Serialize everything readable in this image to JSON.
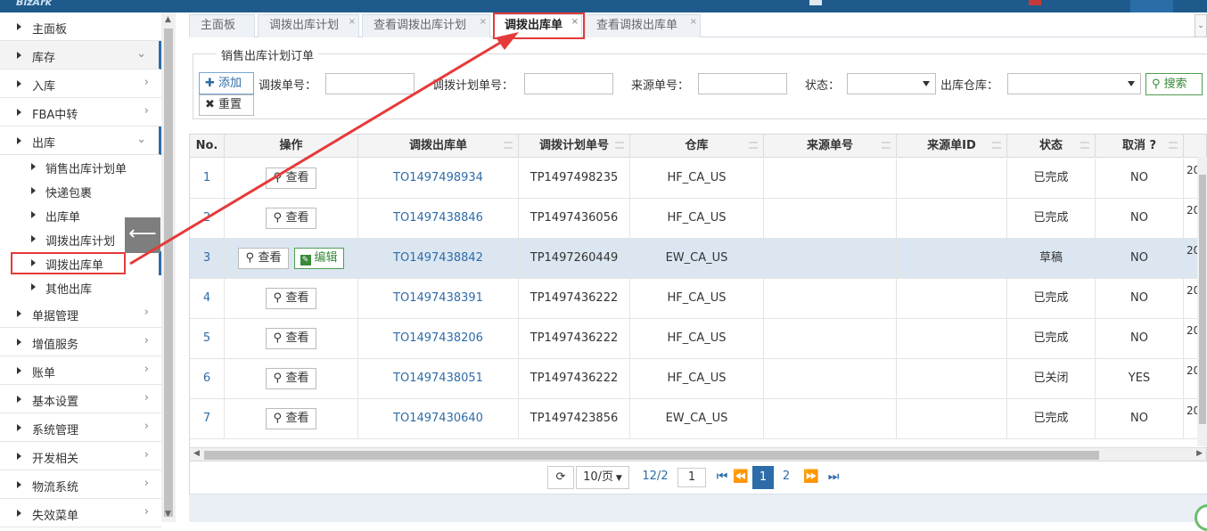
{
  "app": {
    "logo": "BizArk"
  },
  "sidebar": {
    "items": [
      {
        "label": "主面板",
        "chevron": ""
      },
      {
        "label": "库存",
        "chevron": "⌄"
      },
      {
        "label": "入库",
        "chevron": "›"
      },
      {
        "label": "FBA中转",
        "chevron": "›"
      },
      {
        "label": "出库",
        "chevron": "⌄"
      },
      {
        "label": "单据管理",
        "chevron": "›"
      },
      {
        "label": "增值服务",
        "chevron": "›"
      },
      {
        "label": "账单",
        "chevron": "›"
      },
      {
        "label": "基本设置",
        "chevron": "›"
      },
      {
        "label": "系统管理",
        "chevron": "›"
      },
      {
        "label": "开发相关",
        "chevron": "›"
      },
      {
        "label": "物流系统",
        "chevron": "›"
      },
      {
        "label": "失效菜单",
        "chevron": "›"
      }
    ],
    "subitems": [
      {
        "label": "销售出库计划单"
      },
      {
        "label": "快递包裹"
      },
      {
        "label": "出库单"
      },
      {
        "label": "调拨出库计划"
      },
      {
        "label": "调拨出库单"
      },
      {
        "label": "其他出库"
      }
    ],
    "collapse_icon": "⟵"
  },
  "tabs": [
    {
      "label": "主面板"
    },
    {
      "label": "调拨出库计划",
      "close": "×"
    },
    {
      "label": "查看调拨出库计划",
      "close": "×"
    },
    {
      "label": "调拨出库单",
      "close": "×"
    },
    {
      "label": "查看调拨出库单",
      "close": "×"
    }
  ],
  "filter": {
    "legend": "销售出库计划订单",
    "add_label": "添加",
    "reset_label": "重置",
    "search_label": "搜索",
    "fields": [
      {
        "label": "调拨单号："
      },
      {
        "label": "调拨计划单号："
      },
      {
        "label": "来源单号："
      },
      {
        "label": "状态："
      },
      {
        "label": "出库仓库："
      }
    ]
  },
  "table": {
    "columns": [
      "No.",
      "操作",
      "调拨出库单",
      "调拨计划单号",
      "仓库",
      "来源单号",
      "来源单ID",
      "状态",
      "取消 ?"
    ],
    "view_label": "查看",
    "edit_label": "编辑",
    "rows": [
      {
        "no": "1",
        "order": "TO1497498934",
        "plan": "TP1497498235",
        "warehouse": "HF_CA_US",
        "status": "已完成",
        "cancel": "NO",
        "extra": "20"
      },
      {
        "no": "2",
        "order": "TO1497438846",
        "plan": "TP1497436056",
        "warehouse": "HF_CA_US",
        "status": "已完成",
        "cancel": "NO",
        "extra": "20"
      },
      {
        "no": "3",
        "order": "TO1497438842",
        "plan": "TP1497260449",
        "warehouse": "EW_CA_US",
        "status": "草稿",
        "cancel": "NO",
        "extra": "20",
        "editable": true
      },
      {
        "no": "4",
        "order": "TO1497438391",
        "plan": "TP1497436222",
        "warehouse": "HF_CA_US",
        "status": "已完成",
        "cancel": "NO",
        "extra": "20"
      },
      {
        "no": "5",
        "order": "TO1497438206",
        "plan": "TP1497436222",
        "warehouse": "HF_CA_US",
        "status": "已完成",
        "cancel": "NO",
        "extra": "20"
      },
      {
        "no": "6",
        "order": "TO1497438051",
        "plan": "TP1497436222",
        "warehouse": "HF_CA_US",
        "status": "已关闭",
        "cancel": "YES",
        "extra": "20"
      },
      {
        "no": "7",
        "order": "TO1497430640",
        "plan": "TP1497423856",
        "warehouse": "EW_CA_US",
        "status": "已完成",
        "cancel": "NO",
        "extra": "20"
      }
    ]
  },
  "pager": {
    "page_size": "10/页",
    "page_info": "12/2",
    "page_input": "1",
    "pages": [
      "1",
      "2"
    ]
  },
  "colors": {
    "accent": "#2d6ca8",
    "annotation": "#e53a3a",
    "success": "#3a8a3a"
  }
}
